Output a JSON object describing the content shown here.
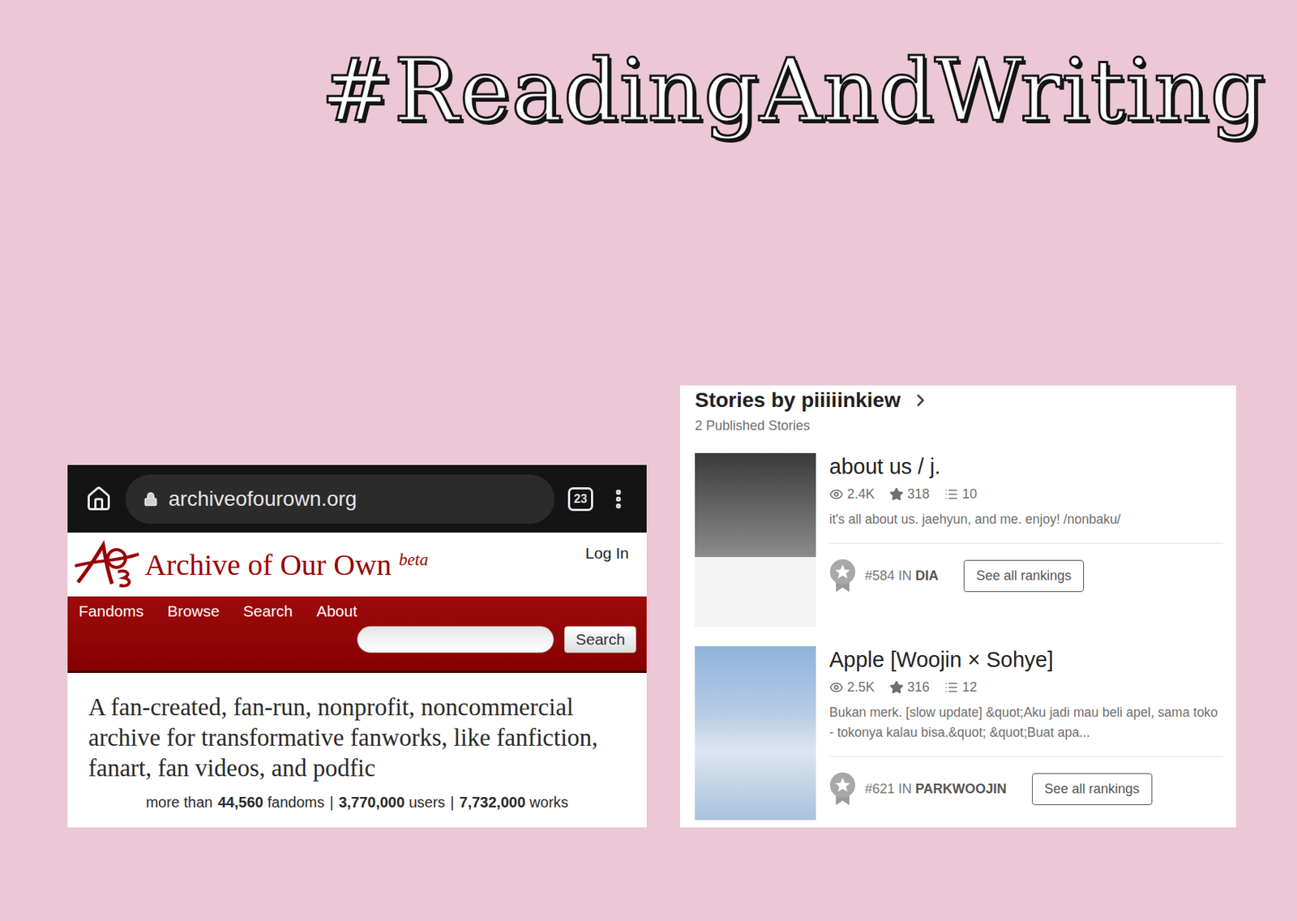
{
  "title": "#ReadingAndWriting",
  "browser": {
    "url": "archiveofourown.org",
    "tab_count": "23"
  },
  "site": {
    "name": "Archive of Our Own",
    "badge": "beta",
    "login": "Log In",
    "nav": [
      "Fandoms",
      "Browse",
      "Search",
      "About"
    ],
    "search_button": "Search",
    "tagline": "A fan-created, fan-run, nonprofit, noncommercial archive for transformative fanworks, like fanfiction, fanart, fan videos, and podfic",
    "stats_prefix": "more than",
    "stats": [
      {
        "value": "44,560",
        "label": "fandoms"
      },
      {
        "value": "3,770,000",
        "label": "users"
      },
      {
        "value": "7,732,000",
        "label": "works"
      }
    ],
    "separator": "|"
  },
  "profile": {
    "title": "Stories by piiiiinkiew",
    "count": "2 Published Stories",
    "stories": [
      {
        "title": "about us / j.",
        "views": "2.4K",
        "votes": "318",
        "parts": "10",
        "description": "it's all about us. jaehyun, and me. enjoy! /nonbaku/",
        "rank": "#584",
        "rank_in": "IN",
        "rank_tag": "DIA",
        "button": "See all rankings"
      },
      {
        "title": "Apple [Woojin × Sohye]",
        "views": "2.5K",
        "votes": "316",
        "parts": "12",
        "description": "Bukan merk. [slow update] &quot;Aku jadi mau beli apel, sama toko - tokonya kalau bisa.&quot; &quot;Buat apa...",
        "rank": "#621",
        "rank_in": "IN",
        "rank_tag": "PARKWOOJIN",
        "button": "See all rankings"
      }
    ]
  }
}
